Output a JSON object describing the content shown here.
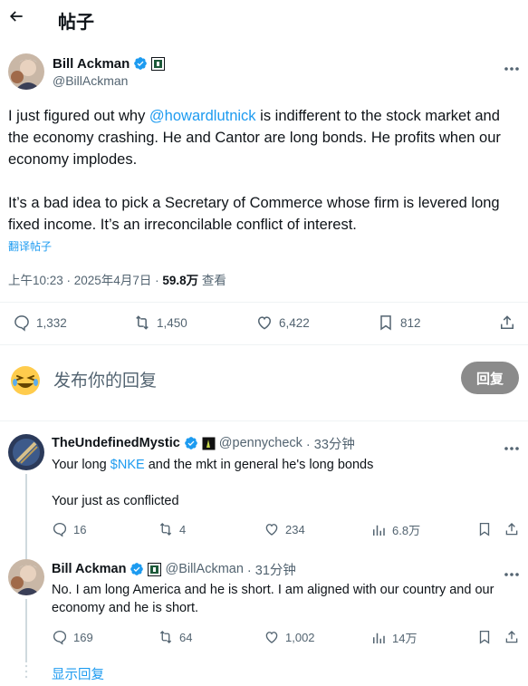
{
  "header": {
    "title": "帖子"
  },
  "main_post": {
    "author_name": "Bill Ackman",
    "handle": "@BillAckman",
    "text_p1_a": "I just figured out why ",
    "mention": "@howardlutnick",
    "text_p1_b": " is indifferent to the stock market and the economy crashing. He and Cantor are long bonds. He profits when our economy implodes.",
    "text_p2": "It’s a bad idea to pick a Secretary of Commerce whose firm is levered long fixed income. It’s an irreconcilable conflict of interest.",
    "translate": "翻译帖子",
    "time": "上午10:23 · 2025年4月7日 · ",
    "views": "59.8万",
    "views_label": " 查看",
    "stats": {
      "replies": "1,332",
      "reposts": "1,450",
      "likes": "6,422",
      "bookmarks": "812"
    }
  },
  "compose": {
    "placeholder": "发布你的回复",
    "button": "回复"
  },
  "replies": [
    {
      "author_name": "TheUndefinedMystic",
      "handle": "@pennycheck",
      "time": "· 33分钟",
      "line1_a": "Your long ",
      "cashtag": "$NKE",
      "line1_b": " and the mkt in general  he's long bonds",
      "line2": "Your just as conflicted",
      "stats": {
        "replies": "16",
        "reposts": "4",
        "likes": "234",
        "views": "6.8万"
      }
    },
    {
      "author_name": "Bill Ackman",
      "handle": "@BillAckman",
      "time": "· 31分钟",
      "text": "No. I am long America and he is short. I am aligned with our country and our economy and he is short.",
      "stats": {
        "replies": "169",
        "reposts": "64",
        "likes": "1,002",
        "views": "14万"
      }
    }
  ],
  "show_replies": "显示回复",
  "colors": {
    "accent": "#1d9bf0",
    "text": "#0f1419",
    "muted": "#536471",
    "divider": "#eff3f4",
    "reply_button": "#8b8b8b"
  }
}
